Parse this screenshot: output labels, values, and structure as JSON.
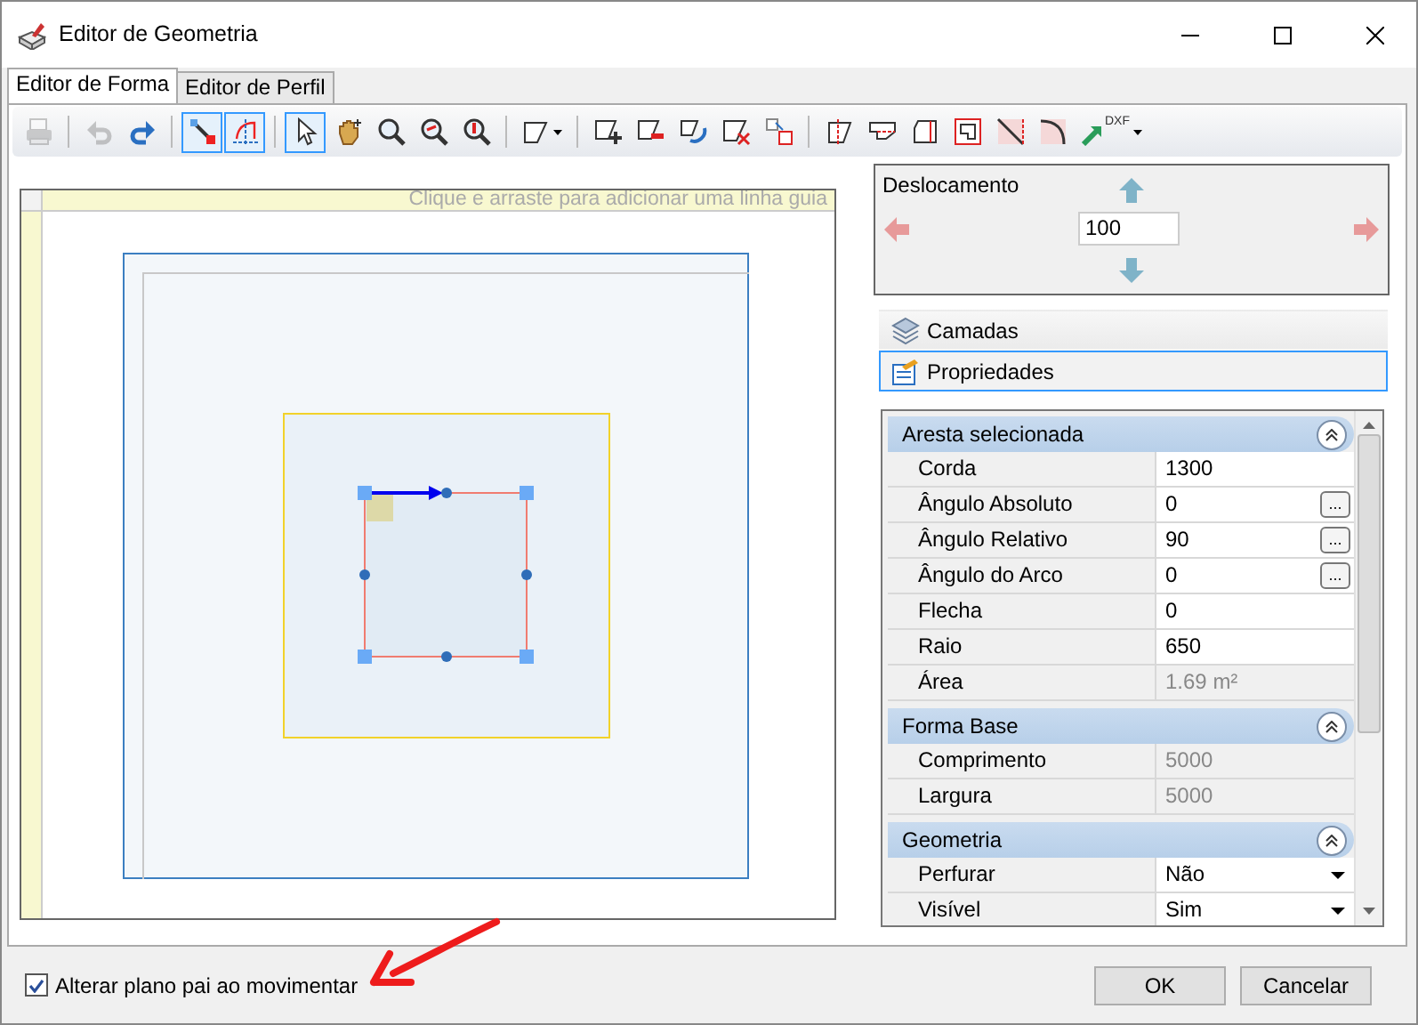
{
  "window": {
    "title": "Editor de Geometria"
  },
  "tabs": [
    {
      "label": "Editor de Forma",
      "selected": true
    },
    {
      "label": "Editor de Perfil",
      "selected": false
    }
  ],
  "toolbar": [
    [
      {
        "kind": "button",
        "selected": false,
        "disabled": true
      }
    ],
    [
      {
        "kind": "button",
        "selected": false,
        "disabled": true
      },
      {
        "kind": "button",
        "selected": false,
        "disabled": false
      }
    ],
    [
      {
        "kind": "button",
        "selected": true,
        "disabled": false
      },
      {
        "kind": "button",
        "selected": true,
        "disabled": false
      }
    ],
    [
      {
        "kind": "button",
        "selected": true,
        "disabled": false
      },
      {
        "kind": "button",
        "selected": false,
        "disabled": false
      },
      {
        "kind": "button",
        "selected": false,
        "disabled": false
      },
      {
        "kind": "button",
        "selected": false,
        "disabled": false
      },
      {
        "kind": "button",
        "selected": false,
        "disabled": false
      }
    ],
    [
      {
        "kind": "dropdown",
        "selected": false,
        "disabled": false
      }
    ],
    [
      {
        "kind": "button",
        "selected": false,
        "disabled": false
      },
      {
        "kind": "button",
        "selected": false,
        "disabled": false
      },
      {
        "kind": "button",
        "selected": false,
        "disabled": false
      },
      {
        "kind": "button",
        "selected": false,
        "disabled": false
      },
      {
        "kind": "button",
        "selected": false,
        "disabled": false
      }
    ],
    [
      {
        "kind": "button",
        "selected": false,
        "disabled": false
      },
      {
        "kind": "button",
        "selected": false,
        "disabled": false
      },
      {
        "kind": "button",
        "selected": false,
        "disabled": false
      },
      {
        "kind": "button",
        "selected": false,
        "disabled": false
      },
      {
        "kind": "button",
        "selected": false,
        "disabled": false
      },
      {
        "kind": "button",
        "selected": false,
        "disabled": false
      },
      {
        "kind": "dropdown",
        "selected": false,
        "disabled": false,
        "label": "DXF"
      }
    ]
  ],
  "canvas": {
    "ruler_hint": "Clique e arraste para adicionar uma linha guia"
  },
  "offset_panel": {
    "title": "Deslocamento",
    "value": "100"
  },
  "panels": [
    {
      "label": "Camadas",
      "selected": false
    },
    {
      "label": "Propriedades",
      "selected": true
    }
  ],
  "property_grid": {
    "sections": [
      {
        "title": "Aresta selecionada",
        "expanded": true,
        "rows": [
          {
            "label": "Corda",
            "value": "1300",
            "kind": "edit"
          },
          {
            "label": "Ângulo Absoluto",
            "value": "0",
            "kind": "ellipsis",
            "button": "..."
          },
          {
            "label": "Ângulo Relativo",
            "value": "90",
            "kind": "ellipsis",
            "button": "..."
          },
          {
            "label": "Ângulo do Arco",
            "value": "0",
            "kind": "ellipsis",
            "button": "..."
          },
          {
            "label": "Flecha",
            "value": "0",
            "kind": "edit"
          },
          {
            "label": "Raio",
            "value": "650",
            "kind": "edit"
          },
          {
            "label": "Área",
            "value": "1.69 m²",
            "kind": "readonly"
          }
        ]
      },
      {
        "title": "Forma Base",
        "expanded": true,
        "rows": [
          {
            "label": "Comprimento",
            "value": "5000",
            "kind": "readonly"
          },
          {
            "label": "Largura",
            "value": "5000",
            "kind": "readonly"
          }
        ]
      },
      {
        "title": "Geometria",
        "expanded": true,
        "rows": [
          {
            "label": "Perfurar",
            "value": "Não",
            "kind": "dropdown"
          },
          {
            "label": "Visível",
            "value": "Sim",
            "kind": "dropdown"
          }
        ]
      }
    ]
  },
  "footer": {
    "checkbox": {
      "label": "Alterar plano pai ao movimentar",
      "checked": true
    },
    "buttons": [
      "OK",
      "Cancelar"
    ]
  }
}
